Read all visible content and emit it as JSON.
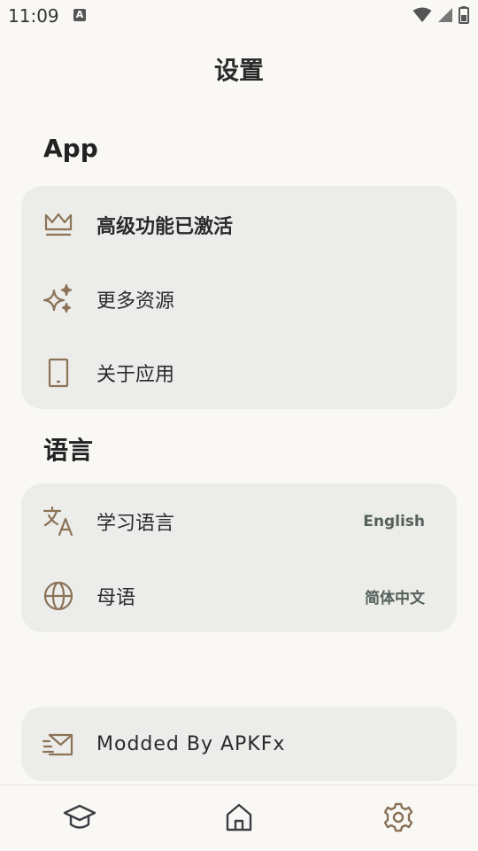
{
  "status_bar": {
    "time": "11:09",
    "notification_icon": "a-icon",
    "icons": [
      "wifi-icon",
      "signal-icon",
      "battery-icon"
    ]
  },
  "page_title": "设置",
  "sections": {
    "app": {
      "header": "App",
      "items": [
        {
          "label": "高级功能已激活",
          "icon": "crown-icon"
        },
        {
          "label": "更多资源",
          "icon": "sparkle-icon"
        },
        {
          "label": "关于应用",
          "icon": "phone-icon"
        }
      ]
    },
    "language": {
      "header": "语言",
      "items": [
        {
          "label": "学习语言",
          "value": "English",
          "icon": "translate-icon"
        },
        {
          "label": "母语",
          "value": "简体中文",
          "icon": "globe-icon"
        }
      ]
    },
    "misc": {
      "items": [
        {
          "label": "Modded By APKFx",
          "icon": "mail-icon"
        }
      ]
    }
  },
  "bottom_nav": {
    "items": [
      {
        "name": "learn",
        "icon": "graduation-cap-icon"
      },
      {
        "name": "home",
        "icon": "home-icon"
      },
      {
        "name": "settings",
        "icon": "gear-icon",
        "active": true
      }
    ]
  },
  "colors": {
    "background": "#f9f8f5",
    "card": "#ececea",
    "icon_brown": "#8a7356",
    "nav_dark": "#3b3f44",
    "value_text": "#55605a"
  }
}
